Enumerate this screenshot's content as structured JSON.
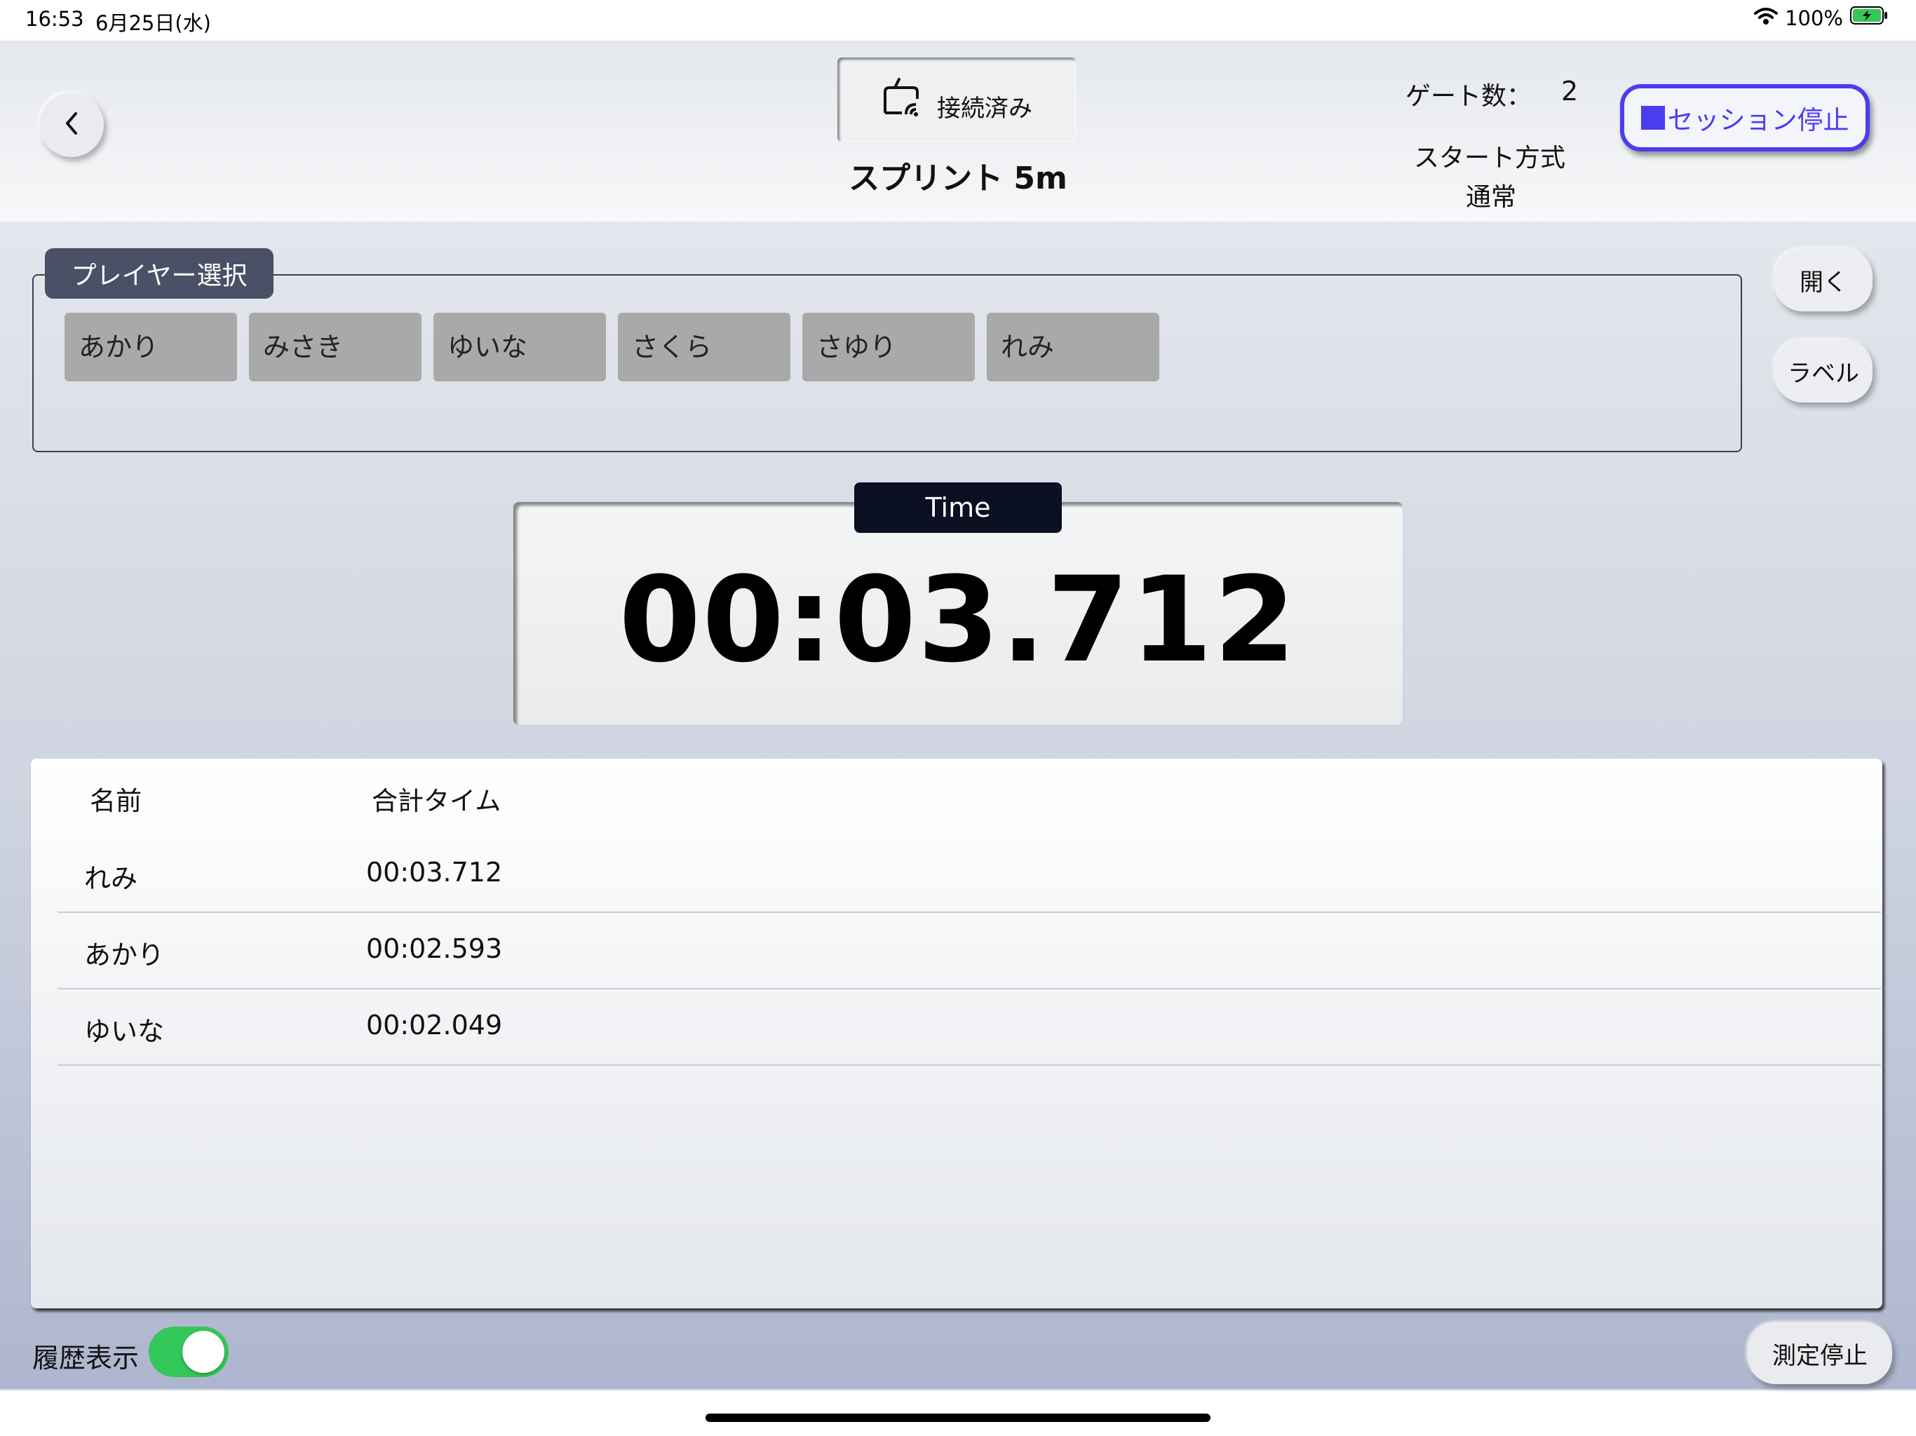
{
  "status_bar": {
    "time": "16:53",
    "date": "6月25日(水)",
    "battery": "100%"
  },
  "header": {
    "connection_label": "接続済み",
    "title": "スプリント 5m",
    "gate_count_label": "ゲート数：",
    "gate_count_value": "2",
    "start_method_label": "スタート方式",
    "start_method_value": "通常",
    "stop_session_label": "セッション停止"
  },
  "player_select": {
    "title": "プレイヤー選択",
    "players": [
      "あかり",
      "みさき",
      "ゆいな",
      "さくら",
      "さゆり",
      "れみ"
    ]
  },
  "side_buttons": {
    "open_label": "開く",
    "label_label": "ラベル"
  },
  "timer": {
    "label": "Time",
    "value": "00:03.712"
  },
  "results_table": {
    "headers": {
      "name": "名前",
      "total_time": "合計タイム"
    },
    "rows": [
      {
        "name": "れみ",
        "time": "00:03.712"
      },
      {
        "name": "あかり",
        "time": "00:02.593"
      },
      {
        "name": "ゆいな",
        "time": "00:02.049"
      }
    ]
  },
  "footer": {
    "history_label": "履歴表示",
    "history_on": true,
    "measure_stop_label": "測定停止"
  },
  "colors": {
    "accent": "#4a3df0",
    "toggle_on": "#34c759",
    "timer_tab": "#0b0f22",
    "player_tab": "#4a5065"
  }
}
